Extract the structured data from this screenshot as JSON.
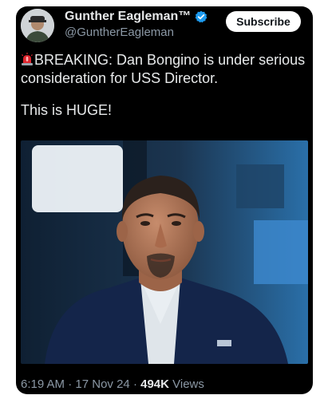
{
  "author": {
    "display_name": "Gunther Eagleman™",
    "handle": "@GuntherEagleman",
    "verified_icon": "verified-badge-icon",
    "accent_color": "#1d9bf0"
  },
  "subscribe_label": "Subscribe",
  "tweet": {
    "siren_icon": "rotating-light-siren-icon",
    "line1": "BREAKING: Dan Bongino is under serious consideration for USS Director.",
    "line2": "This is HUGE!"
  },
  "media": {
    "kind": "photo"
  },
  "meta": {
    "time": "6:19 AM",
    "sep1": " · ",
    "date": "17 Nov 24",
    "sep2": " · ",
    "views_count": "494K",
    "views_label": " Views"
  }
}
